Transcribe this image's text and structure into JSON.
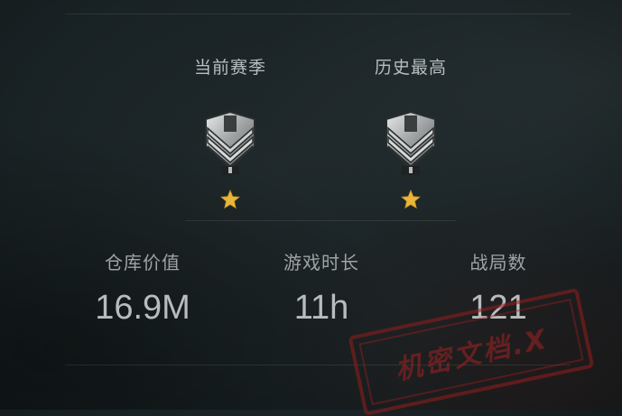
{
  "ranks": {
    "current": {
      "title": "当前赛季",
      "badge": "rank-chevron-badge",
      "stars": 1
    },
    "best": {
      "title": "历史最高",
      "badge": "rank-chevron-badge",
      "stars": 1
    }
  },
  "stats": {
    "warehouse_value": {
      "label": "仓库价值",
      "value": "16.9M"
    },
    "play_time": {
      "label": "游戏时长",
      "value": "11h"
    },
    "matches": {
      "label": "战局数",
      "value": "121"
    }
  },
  "watermark": {
    "text": "机密文档.X"
  },
  "colors": {
    "star": "#e8b63a",
    "stamp": "#a02323"
  }
}
